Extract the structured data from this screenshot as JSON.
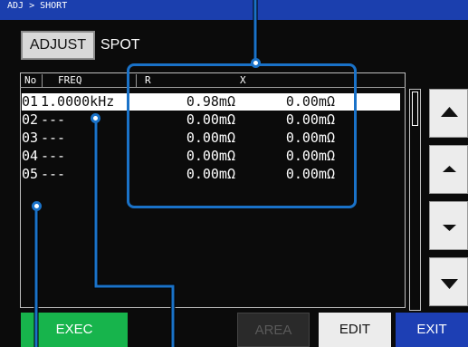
{
  "breadcrumb": "ADJ > SHORT",
  "adjust_label": "ADJUST",
  "mode_label": "SPOT",
  "columns": {
    "no": "No",
    "freq": "FREQ",
    "r": "R",
    "x": "X"
  },
  "rows": [
    {
      "no": "01",
      "freq": "1.0000kHz",
      "r": "0.98mΩ",
      "x": "0.00mΩ",
      "selected": true
    },
    {
      "no": "02",
      "freq": "---",
      "r": "0.00mΩ",
      "x": "0.00mΩ",
      "selected": false
    },
    {
      "no": "03",
      "freq": "---",
      "r": "0.00mΩ",
      "x": "0.00mΩ",
      "selected": false
    },
    {
      "no": "04",
      "freq": "---",
      "r": "0.00mΩ",
      "x": "0.00mΩ",
      "selected": false
    },
    {
      "no": "05",
      "freq": "---",
      "r": "0.00mΩ",
      "x": "0.00mΩ",
      "selected": false
    }
  ],
  "buttons": {
    "exec": "EXEC",
    "area": "AREA",
    "edit": "EDIT",
    "exit": "EXIT"
  },
  "icons": {
    "nav": [
      "page-up-icon",
      "line-up-icon",
      "line-down-icon",
      "page-down-icon"
    ]
  },
  "colors": {
    "breadcrumb_bar": "#1b3fae",
    "exec": "#17b44c",
    "exit": "#1d3fb4",
    "callout": "#1a72c8"
  }
}
